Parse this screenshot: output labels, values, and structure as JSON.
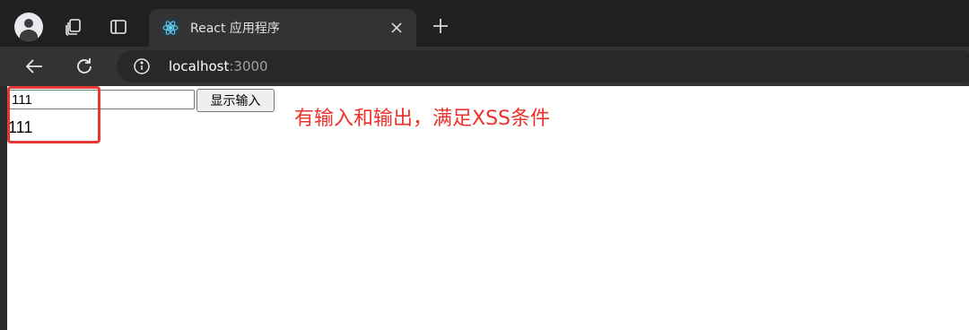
{
  "browser": {
    "tab": {
      "title": "React 应用程序",
      "favicon": "react-icon"
    },
    "address": {
      "host": "localhost",
      "port": ":3000"
    },
    "icons": [
      "profile-icon",
      "workspaces-icon",
      "tab-search-icon",
      "react-icon",
      "close-icon",
      "new-tab-icon",
      "back-icon",
      "reload-icon",
      "site-info-icon"
    ]
  },
  "page": {
    "input": {
      "value": "111",
      "placeholder": ""
    },
    "button_label": "显示输入",
    "output_text": "111"
  },
  "annotation": {
    "text": "有输入和输出，满足XSS条件",
    "color": "#f0302a"
  },
  "colors": {
    "highlight_box": "#e53935",
    "tab_bar": "#202020",
    "toolbar": "#333333",
    "react_accent": "#61dafb"
  }
}
